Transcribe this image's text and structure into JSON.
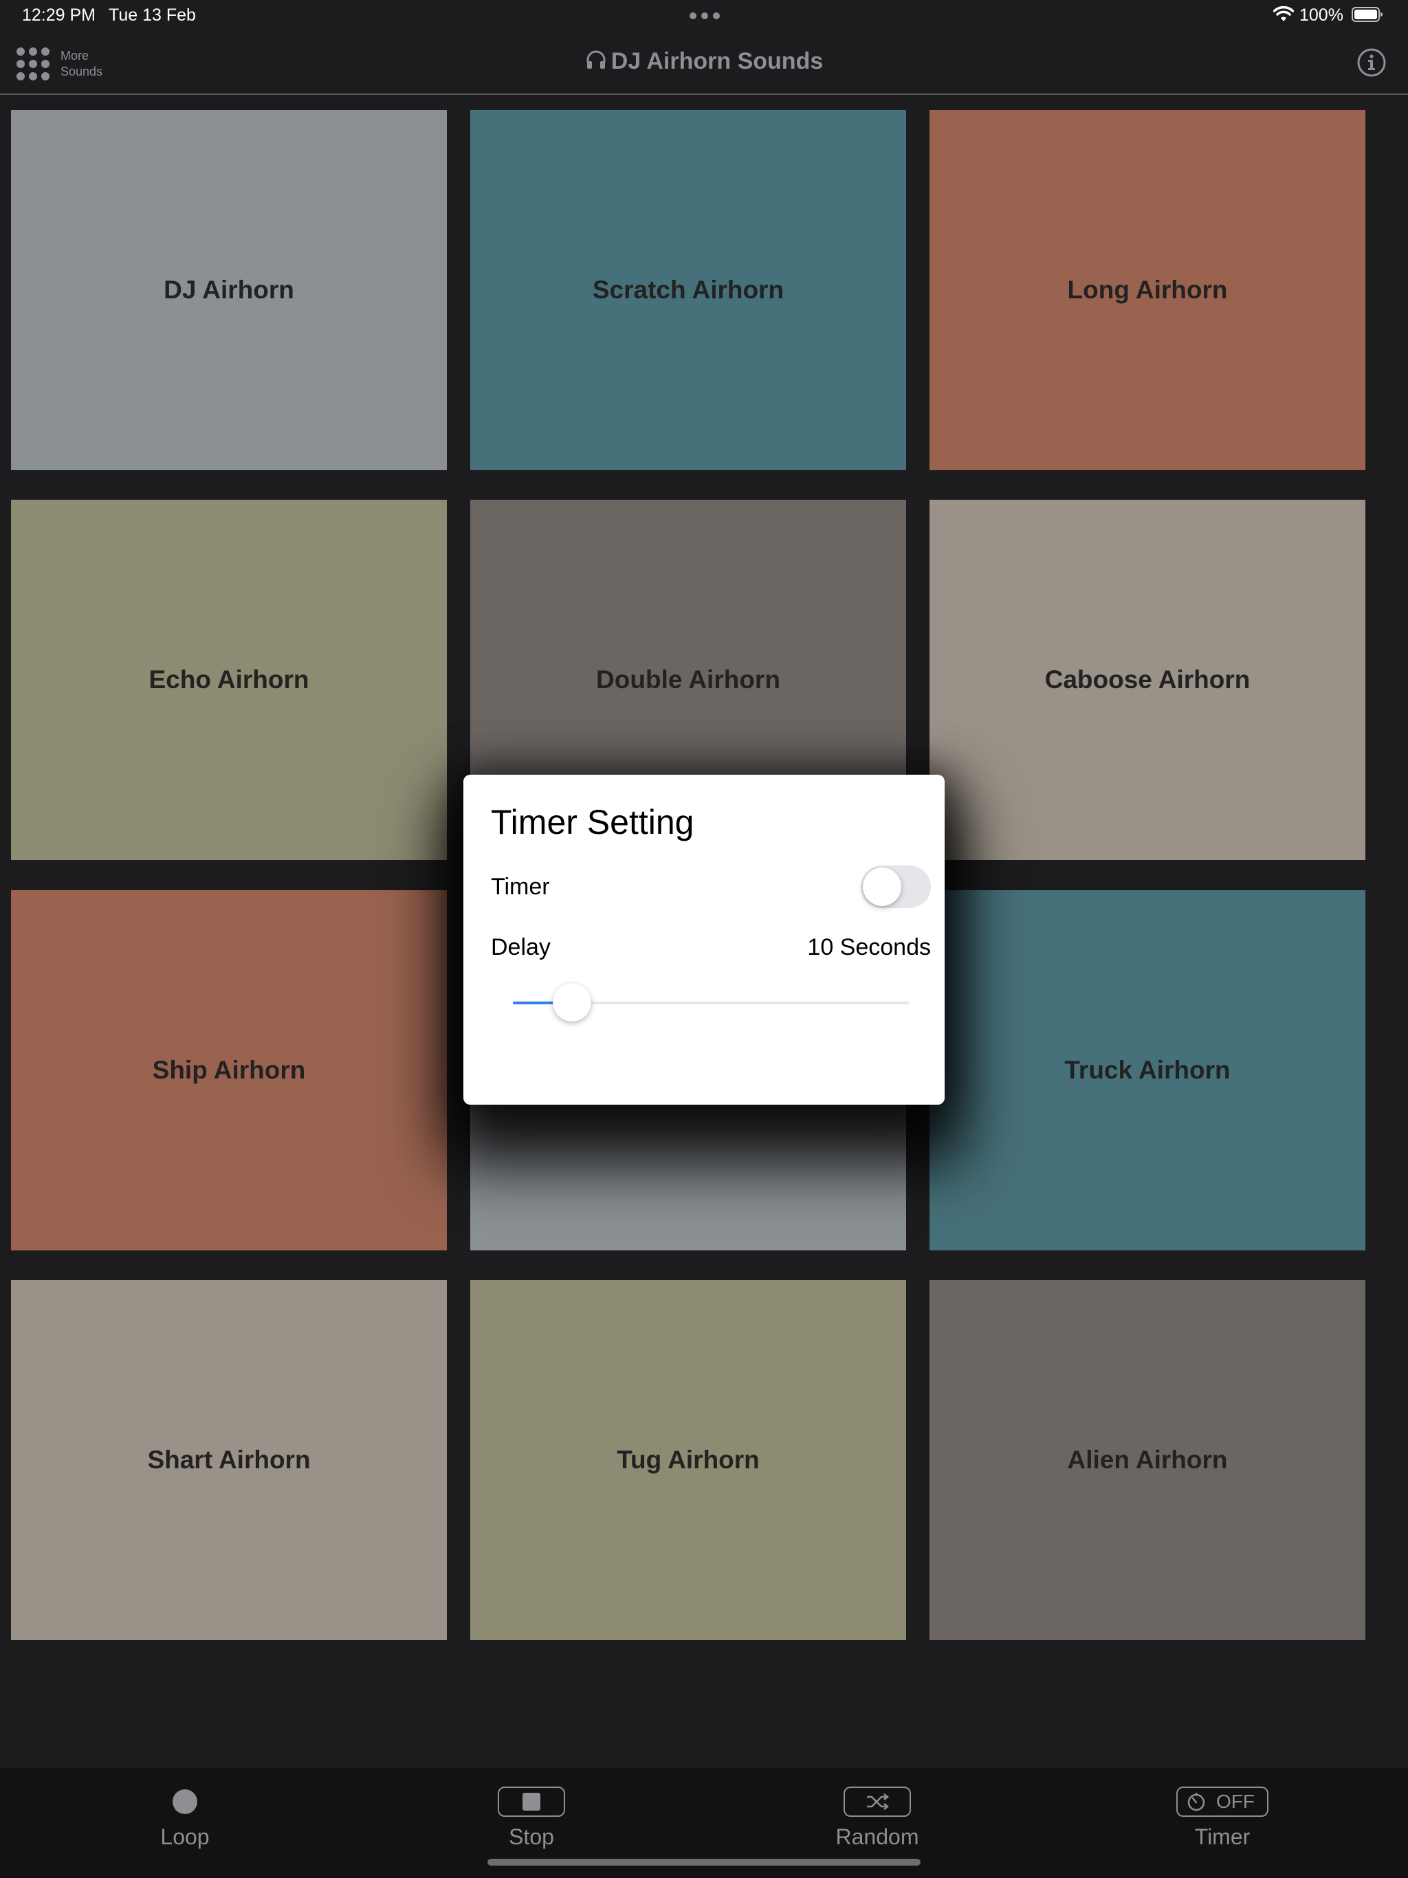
{
  "status_bar": {
    "time": "12:29 PM",
    "date": "Tue 13 Feb",
    "battery": "100%"
  },
  "nav": {
    "more_label_line1": "More",
    "more_label_line2": "Sounds",
    "title": "DJ Airhorn Sounds",
    "icons": [
      "grid-icon",
      "headphones-icon",
      "info-icon"
    ]
  },
  "tiles": [
    {
      "label": "DJ Airhorn",
      "color": "#8b9095"
    },
    {
      "label": "Scratch Airhorn",
      "color": "#47717a"
    },
    {
      "label": "Long Airhorn",
      "color": "#9a6350"
    },
    {
      "label": "Echo Airhorn",
      "color": "#8d8b72"
    },
    {
      "label": "Double Airhorn",
      "color": "#6c6663"
    },
    {
      "label": "Caboose Airhorn",
      "color": "#9a9288"
    },
    {
      "label": "Ship Airhorn",
      "color": "#9a6350"
    },
    {
      "label": "",
      "color": "#8b9095"
    },
    {
      "label": "Truck Airhorn",
      "color": "#47717a"
    },
    {
      "label": "Shart Airhorn",
      "color": "#9a9288"
    },
    {
      "label": "Tug Airhorn",
      "color": "#8d8b72"
    },
    {
      "label": "Alien Airhorn",
      "color": "#6c6663"
    }
  ],
  "dialog": {
    "title": "Timer Setting",
    "timer_label": "Timer",
    "timer_on": false,
    "delay_label": "Delay",
    "delay_value": "10 Seconds",
    "slider_fraction": 0.15,
    "accent": "#2f80ed"
  },
  "toolbar": {
    "loop": "Loop",
    "stop": "Stop",
    "random": "Random",
    "timer": "Timer",
    "timer_state": "OFF"
  }
}
